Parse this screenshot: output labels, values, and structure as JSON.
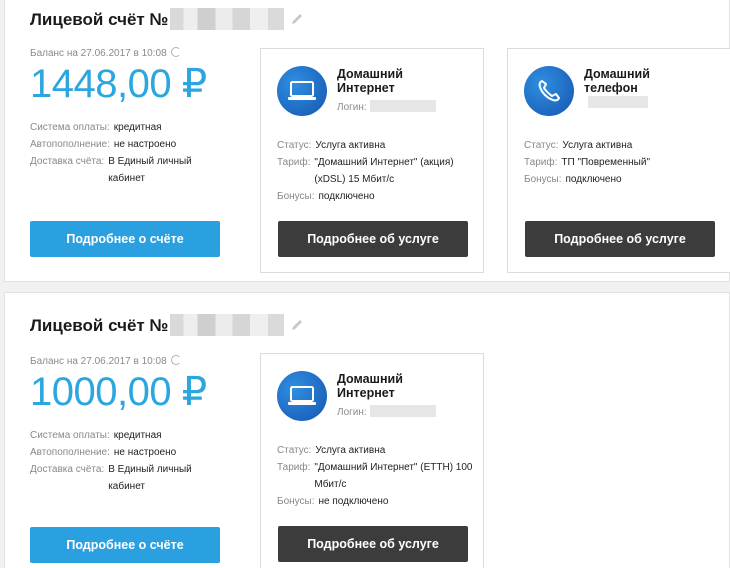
{
  "accounts": [
    {
      "title": "Лицевой счёт №",
      "balance_date": "Баланс на 27.06.2017 в 10:08",
      "balance": "1448,00 ₽",
      "payment_key": "Система оплаты:",
      "payment_val": "кредитная",
      "autopay_key": "Автопополнение:",
      "autopay_val": "не настроено",
      "delivery_key": "Доставка счёта:",
      "delivery_val": "В Единый личный кабинет",
      "details_button": "Подробнее о счёте",
      "services": [
        {
          "name": "Домашний Интернет",
          "icon": "laptop-icon",
          "login_label": "Логин:",
          "status_key": "Статус:",
          "status_val": "Услуга активна",
          "tariff_key": "Тариф:",
          "tariff_val": "\"Домашний Интернет\" (акция) (xDSL) 15 Мбит/с",
          "bonus_key": "Бонусы:",
          "bonus_val": "подключено",
          "button": "Подробнее об услуге"
        },
        {
          "name": "Домашний телефон",
          "icon": "phone-icon",
          "status_key": "Статус:",
          "status_val": "Услуга активна",
          "tariff_key": "Тариф:",
          "tariff_val": "ТП \"Повременный\"",
          "bonus_key": "Бонусы:",
          "bonus_val": "подключено",
          "button": "Подробнее об услуге"
        }
      ]
    },
    {
      "title": "Лицевой счёт №",
      "balance_date": "Баланс на 27.06.2017 в 10:08",
      "balance": "1000,00 ₽",
      "payment_key": "Система оплаты:",
      "payment_val": "кредитная",
      "autopay_key": "Автопополнение:",
      "autopay_val": "не настроено",
      "delivery_key": "Доставка счёта:",
      "delivery_val": "В Единый личный кабинет",
      "details_button": "Подробнее о счёте",
      "services": [
        {
          "name": "Домашний Интернет",
          "icon": "laptop-icon",
          "login_label": "Логин:",
          "status_key": "Статус:",
          "status_val": "Услуга активна",
          "tariff_key": "Тариф:",
          "tariff_val": "\"Домашний Интернет\" (ETTH) 100 Мбит/с",
          "bonus_key": "Бонусы:",
          "bonus_val": "не подключено",
          "button": "Подробнее об услуге"
        }
      ]
    }
  ],
  "colors": {
    "accent": "#2ba6de",
    "primary_button": "#2aa0e0",
    "dark_button": "#3c3c3c"
  }
}
